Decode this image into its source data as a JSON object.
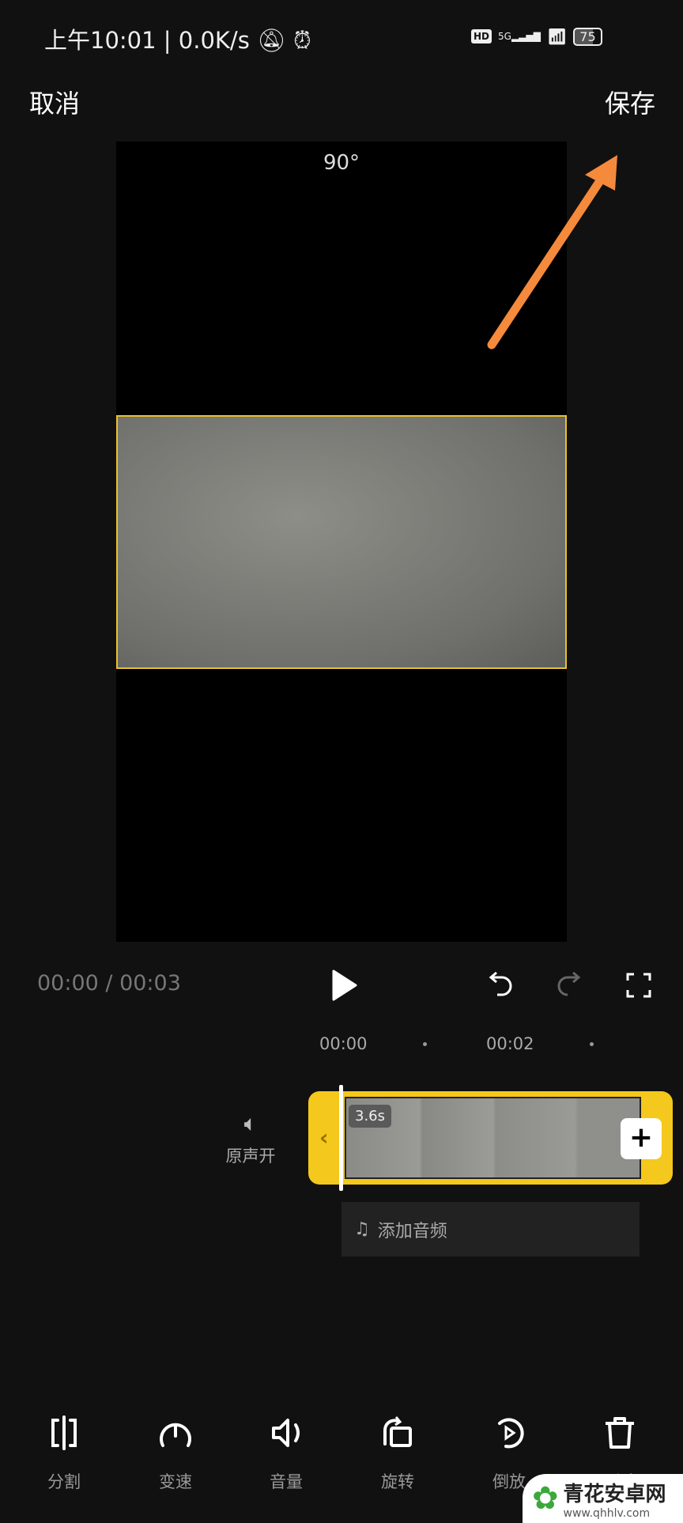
{
  "status_bar": {
    "time": "上午10:01",
    "speed": "0.0K/s",
    "network": "5G",
    "battery": "75",
    "icons": [
      "bell-off-icon",
      "alarm-icon",
      "hd-icon",
      "signal-icon",
      "wifi-icon",
      "battery-icon"
    ]
  },
  "header": {
    "cancel": "取消",
    "save": "保存"
  },
  "preview": {
    "rotation": "90°",
    "frame_color": "#e8c22a"
  },
  "annotation": {
    "arrow_color": "#f58a3c"
  },
  "playback": {
    "time": "00:00 / 00:03"
  },
  "ruler": {
    "ticks": [
      "00:00",
      "00:02"
    ]
  },
  "timeline": {
    "original_sound": "原声开",
    "clip_duration": "3.6s",
    "add_audio": "添加音频",
    "track_color": "#f4c81c"
  },
  "toolbar": {
    "items": [
      {
        "label": "分割",
        "icon": "split-icon"
      },
      {
        "label": "变速",
        "icon": "speed-icon"
      },
      {
        "label": "音量",
        "icon": "volume-icon"
      },
      {
        "label": "旋转",
        "icon": "rotate-icon"
      },
      {
        "label": "倒放",
        "icon": "reverse-icon"
      },
      {
        "label": "删除",
        "icon": "trash-icon"
      }
    ]
  },
  "watermark": {
    "name": "青花安卓网",
    "url": "www.qhhlv.com"
  }
}
